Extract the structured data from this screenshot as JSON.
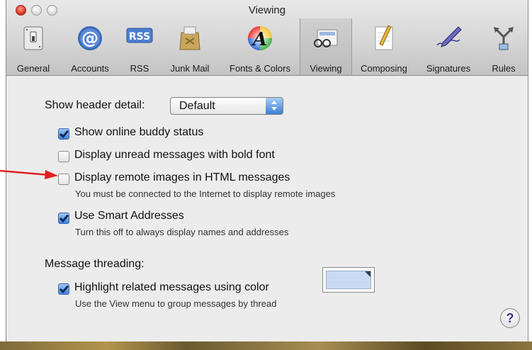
{
  "window": {
    "title": "Viewing"
  },
  "toolbar": {
    "items": [
      {
        "label": "General",
        "icon": "general-switch-icon"
      },
      {
        "label": "Accounts",
        "icon": "at-sign-icon"
      },
      {
        "label": "RSS",
        "icon": "rss-badge-icon"
      },
      {
        "label": "Junk Mail",
        "icon": "junk-mail-bag-icon"
      },
      {
        "label": "Fonts & Colors",
        "icon": "fonts-colors-icon"
      },
      {
        "label": "Viewing",
        "icon": "viewing-glasses-icon"
      },
      {
        "label": "Composing",
        "icon": "composing-pencil-icon"
      },
      {
        "label": "Signatures",
        "icon": "signature-pen-icon"
      },
      {
        "label": "Rules",
        "icon": "rules-arrows-icon"
      }
    ],
    "rss_badge_text": "RSS",
    "fonts_glyph": "A"
  },
  "viewing": {
    "header_detail_label": "Show header detail:",
    "header_detail_value": "Default",
    "show_buddy_status": "Show online buddy status",
    "bold_unread": "Display unread messages with bold font",
    "remote_images": "Display remote images in HTML messages",
    "remote_images_hint": "You must be connected to the Internet to display remote images",
    "smart_addresses": "Use Smart Addresses",
    "smart_addresses_hint": "Turn this off to always display names and addresses",
    "threading_label": "Message threading:",
    "highlight_related": "Highlight related messages using color",
    "highlight_hint": "Use the View menu to group messages by thread",
    "help_glyph": "?"
  },
  "state": {
    "show_buddy_status": true,
    "bold_unread": false,
    "remote_images": false,
    "smart_addresses": true,
    "highlight_related": true
  },
  "colors": {
    "highlight_swatch": "#c9dbf2",
    "arrow": "#e02020"
  }
}
